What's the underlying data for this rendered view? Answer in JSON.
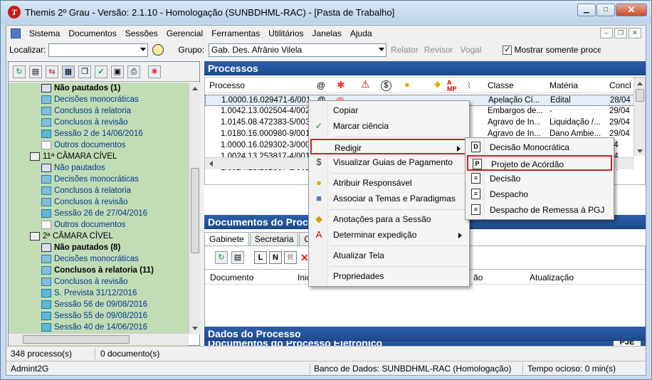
{
  "window": {
    "title": "Themis 2º Grau - Versão: 2.1.10 - Homologação (SUNBDHML-RAC) - [Pasta de Trabalho]",
    "app_icon_letter": "T"
  },
  "menu": [
    "Sistema",
    "Documentos",
    "Sessões",
    "Gerencial",
    "Ferramentas",
    "Utilitários",
    "Janelas",
    "Ajuda"
  ],
  "toolbar": {
    "localizar_label": "Localizar:",
    "localizar_value": "",
    "grupo_label": "Grupo:",
    "grupo_value": "Gab. Des. Afrânio Vilela",
    "relator": "Relator",
    "revisor": "Revisor",
    "vogal": "Vogal",
    "mostrar_label": "Mostrar somente process",
    "mostrar_checked": "✓"
  },
  "tree": [
    {
      "label": "Não pautados (1)",
      "style": "bold",
      "icon": "cal",
      "indent": 40
    },
    {
      "label": "Decisões monocráticas",
      "style": "",
      "icon": "folder",
      "indent": 40
    },
    {
      "label": "Conclusos à relatoria",
      "style": "",
      "icon": "folder",
      "indent": 40
    },
    {
      "label": "Conclusos à revisão",
      "style": "",
      "icon": "folder",
      "indent": 40
    },
    {
      "label": "Sessão 2 de 14/06/2016",
      "style": "",
      "icon": "sess",
      "indent": 40
    },
    {
      "label": "Outros documentos",
      "style": "",
      "icon": "doc",
      "indent": 40
    },
    {
      "label": "11ª CÂMARA CÍVEL",
      "style": "dark",
      "icon": "court",
      "indent": 24
    },
    {
      "label": "Não pautados",
      "style": "",
      "icon": "cal",
      "indent": 40
    },
    {
      "label": "Decisões monocráticas",
      "style": "",
      "icon": "folder",
      "indent": 40
    },
    {
      "label": "Conclusos à relatoria",
      "style": "",
      "icon": "folder",
      "indent": 40
    },
    {
      "label": "Conclusos à revisão",
      "style": "",
      "icon": "folder",
      "indent": 40
    },
    {
      "label": "Sessão 26 de 27/04/2016",
      "style": "",
      "icon": "sess",
      "indent": 40
    },
    {
      "label": "Outros documentos",
      "style": "",
      "icon": "doc",
      "indent": 40
    },
    {
      "label": "2ª CÂMARA CÍVEL",
      "style": "dark",
      "icon": "court",
      "indent": 24
    },
    {
      "label": "Não pautados (8)",
      "style": "bold",
      "icon": "cal",
      "indent": 40
    },
    {
      "label": "Decisões monocráticas",
      "style": "",
      "icon": "folder",
      "indent": 40
    },
    {
      "label": "Conclusos à relatoria (11)",
      "style": "bold",
      "icon": "folder",
      "indent": 40
    },
    {
      "label": "Conclusos à revisão",
      "style": "",
      "icon": "folder",
      "indent": 40
    },
    {
      "label": "S. Prevista 31/12/2016",
      "style": "",
      "icon": "sess",
      "indent": 40
    },
    {
      "label": "Sessão 56 de 09/08/2016",
      "style": "",
      "icon": "sess",
      "indent": 40
    },
    {
      "label": "Sessão 55 de 09/08/2016",
      "style": "",
      "icon": "sess",
      "indent": 40
    },
    {
      "label": "Sessão 40 de 14/06/2016",
      "style": "",
      "icon": "sess",
      "indent": 40
    }
  ],
  "processos": {
    "header": "Processos",
    "columns": {
      "processo": "Processo",
      "classe": "Classe",
      "materia": "Matéria",
      "conclusao": "Concl"
    },
    "rows": [
      {
        "processo": "1.0000.16.029471-6/001",
        "classe": "Apelação Cí...",
        "materia": "Edital",
        "data": "28/04"
      },
      {
        "processo": "1.0042.13.002504-4/002",
        "classe": "Embargos de...",
        "materia": "-",
        "data": "29/04"
      },
      {
        "processo": "1.0145.08.472383-5/003",
        "classe": "Agravo de In...",
        "materia": "Liquidação /...",
        "data": "29/04"
      },
      {
        "processo": "1.0180.16.000980-9/001",
        "classe": "Agravo de In...",
        "materia": "Dano Ambie...",
        "data": "29/04"
      },
      {
        "processo": "1.0000.16.029302-3/000",
        "classe": "",
        "materia": "",
        "data": "04"
      },
      {
        "processo": "1.0024.13.253817-4/001",
        "classe": "",
        "materia": "",
        "data": "04"
      },
      {
        "processo": "1.0024.13.202307-1/001",
        "classe": "",
        "materia": "",
        "data": "04"
      }
    ]
  },
  "documentos": {
    "header": "Documentos do Proce",
    "tabs": [
      "Gabinete",
      "Secretaria",
      "Origi"
    ],
    "buttons": [
      "L",
      "N",
      "R"
    ],
    "columns": {
      "documento": "Documento",
      "inicio": "Inici",
      "situacao": "ão",
      "atualizacao": "Atualização"
    }
  },
  "doc_eletronico": {
    "header": "Documentos do Processo Eletrônico",
    "badge": "PJE"
  },
  "dados": {
    "header": "Dados do Processo"
  },
  "context_menu": [
    {
      "label": "Copiar",
      "icon": ""
    },
    {
      "label": "Marcar ciência",
      "icon": "✓"
    },
    {
      "label": "Redigir",
      "icon": "",
      "submenu": true,
      "highlight": true
    },
    {
      "label": "Visualizar Guias de Pagamento",
      "icon": "$"
    },
    {
      "label": "Atribuir Responsável",
      "icon": "●"
    },
    {
      "label": "Associar a Temas e Paradigmas",
      "icon": "■"
    },
    {
      "label": "Anotações para a Sessão",
      "icon": "◆"
    },
    {
      "label": "Determinar expedição",
      "icon": "A",
      "submenu": true
    },
    {
      "label": "Atualizar Tela",
      "icon": ""
    },
    {
      "label": "Propriedades",
      "icon": ""
    }
  ],
  "submenu": [
    {
      "label": "Decisão Monocrática",
      "letter": "D"
    },
    {
      "label": "Projeto de Acórdão",
      "letter": "P",
      "highlight": true
    },
    {
      "label": "Decisão",
      "letter": "≡"
    },
    {
      "label": "Despacho",
      "letter": "≡"
    },
    {
      "label": "Despacho de Remessa à PGJ",
      "letter": "≡"
    }
  ],
  "status": {
    "processos": "348 processo(s)",
    "documentos": "0 documento(s)",
    "user": "Admint2G",
    "db": "Banco de Dados: SUNBDHML-RAC (Homologação)",
    "idle": "Tempo ocioso: 0 min(s)"
  },
  "colors": {
    "section_header": "#2d5ea8",
    "tree_bg": "#c2dcb6",
    "highlight_border": "#d0202a"
  }
}
